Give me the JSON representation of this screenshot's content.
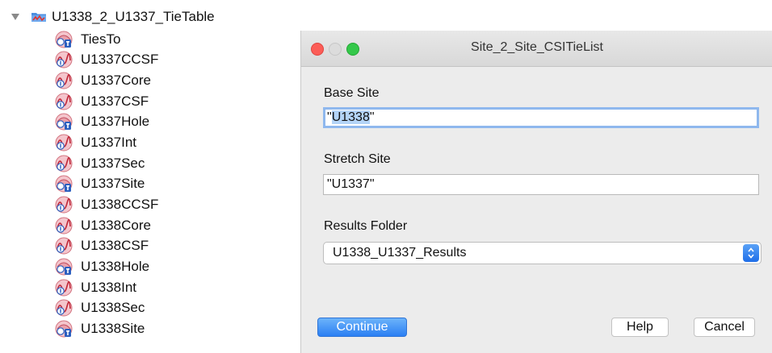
{
  "tree": {
    "root": {
      "label": "U1338_2_U1337_TieTable",
      "expanded": true,
      "icon": "table-folder-icon"
    },
    "items": [
      {
        "label": "TiesTo",
        "icon": "site-icon"
      },
      {
        "label": "U1337CCSF",
        "icon": "wave-icon"
      },
      {
        "label": "U1337Core",
        "icon": "wave-icon"
      },
      {
        "label": "U1337CSF",
        "icon": "wave-icon"
      },
      {
        "label": "U1337Hole",
        "icon": "site-icon"
      },
      {
        "label": "U1337Int",
        "icon": "wave-icon"
      },
      {
        "label": "U1337Sec",
        "icon": "wave-icon"
      },
      {
        "label": "U1337Site",
        "icon": "site-icon"
      },
      {
        "label": "U1338CCSF",
        "icon": "wave-icon"
      },
      {
        "label": "U1338Core",
        "icon": "wave-icon"
      },
      {
        "label": "U1338CSF",
        "icon": "wave-icon"
      },
      {
        "label": "U1338Hole",
        "icon": "site-icon"
      },
      {
        "label": "U1338Int",
        "icon": "wave-icon"
      },
      {
        "label": "U1338Sec",
        "icon": "wave-icon"
      },
      {
        "label": "U1338Site",
        "icon": "site-icon"
      }
    ]
  },
  "dialog": {
    "title": "Site_2_Site_CSITieList",
    "base_site": {
      "label": "Base Site",
      "quote_open": "\"",
      "selected_text": "U1338",
      "quote_close": "\""
    },
    "stretch_site": {
      "label": "Stretch Site",
      "value": "\"U1337\""
    },
    "results_folder": {
      "label": "Results Folder",
      "value": "U1338_U1337_Results"
    },
    "buttons": {
      "continue": "Continue",
      "help": "Help",
      "cancel": "Cancel"
    }
  },
  "colors": {
    "accent": "#2a7ff3",
    "close": "#fc5d57",
    "zoom": "#34c84a",
    "selection": "#b4d4f7"
  }
}
